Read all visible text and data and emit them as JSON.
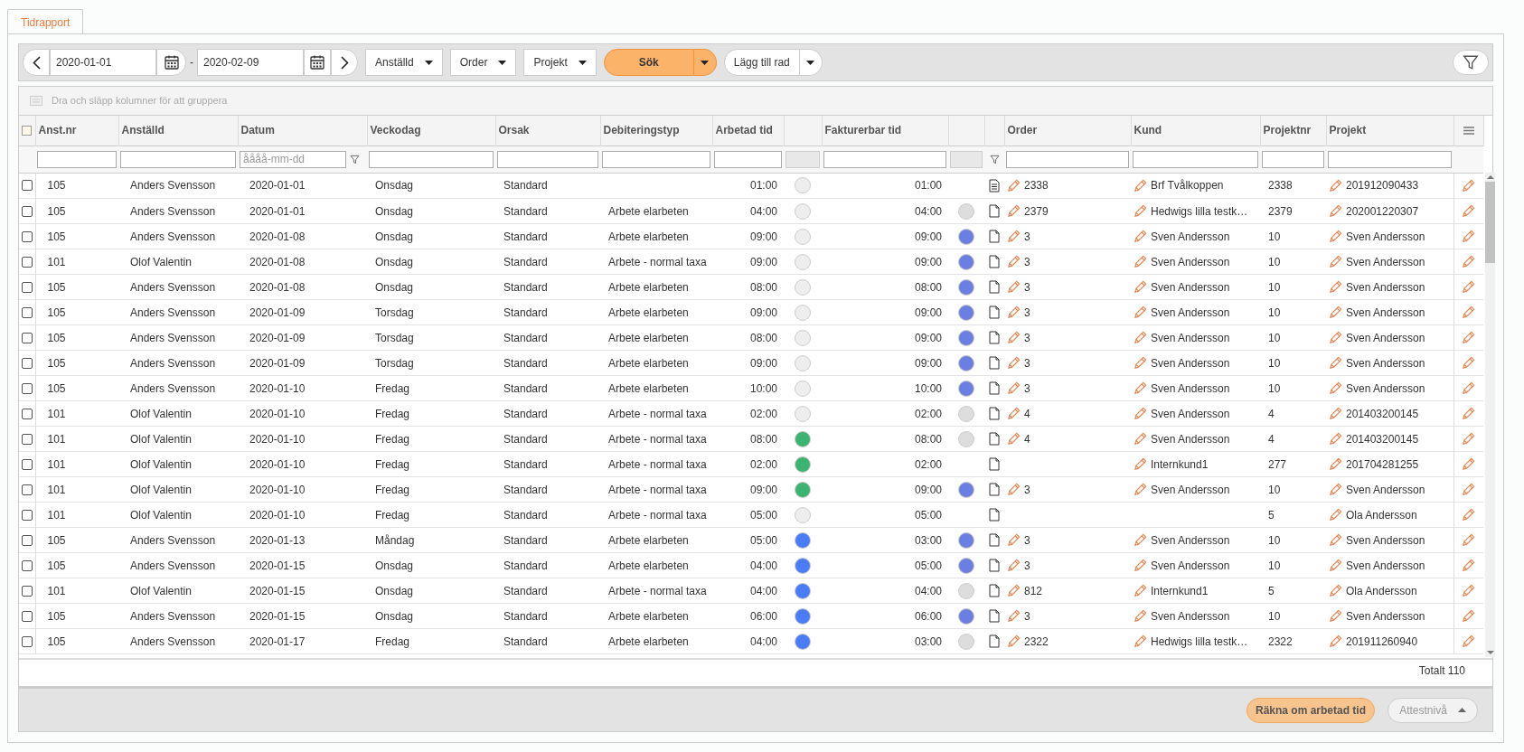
{
  "tabs": [
    {
      "label": "Tidrapport",
      "selected": true
    }
  ],
  "toolbar": {
    "date_from": "2020-01-01",
    "separator": "-",
    "date_to": "2020-02-09",
    "dropdowns": [
      "Anställd",
      "Order",
      "Projekt"
    ],
    "search_button": "Sök",
    "add_row_button": "Lägg till rad"
  },
  "group_panel": {
    "hint": "Dra och släpp kolumner för att gruppera"
  },
  "table": {
    "columns": [
      "Anst.nr",
      "Anställd",
      "Datum",
      "Veckodag",
      "Orsak",
      "Debiteringstyp",
      "Arbetad tid",
      "Fakturerbar tid",
      "Order",
      "Kund",
      "Projektnr",
      "Projekt"
    ],
    "all_selected": false,
    "date_filter_placeholder": "åååå-mm-dd",
    "rows": [
      {
        "selected": false,
        "emp_no": "105",
        "employee": "Anders Svensson",
        "date": "2020-01-01",
        "weekday": "Onsdag",
        "reason": "Standard",
        "worked": "01:00",
        "worked_status": {
          "color": "#eeeeee"
        },
        "billable": "01:00",
        "has_note": true,
        "order": "2338",
        "customer": "Brf Tvålkoppen",
        "project_no": "2338",
        "project": "201912090433"
      },
      {
        "selected": false,
        "emp_no": "105",
        "employee": "Anders Svensson",
        "date": "2020-01-01",
        "weekday": "Onsdag",
        "reason": "Standard",
        "billing_type": "Arbete elarbeten",
        "worked": "04:00",
        "worked_status": {
          "color": "#eeeeee"
        },
        "billable": "04:00",
        "billable_status": {
          "color": "#dddddd"
        },
        "has_note": false,
        "order": "2379",
        "customer": "Hedwigs lilla testk…",
        "project_no": "2379",
        "project": "202001220307"
      },
      {
        "selected": false,
        "emp_no": "105",
        "employee": "Anders Svensson",
        "date": "2020-01-08",
        "weekday": "Onsdag",
        "reason": "Standard",
        "billing_type": "Arbete elarbeten",
        "worked": "09:00",
        "worked_status": {
          "color": "#eeeeee"
        },
        "billable": "09:00",
        "billable_status": {
          "color": "#6b7fe0"
        },
        "has_note": false,
        "order": "3",
        "customer": "Sven Andersson",
        "project_no": "10",
        "project": "Sven Andersson"
      },
      {
        "selected": false,
        "emp_no": "101",
        "employee": "Olof Valentin",
        "date": "2020-01-08",
        "weekday": "Onsdag",
        "reason": "Standard",
        "billing_type": "Arbete - normal taxa",
        "worked": "09:00",
        "worked_status": {
          "color": "#eeeeee"
        },
        "billable": "09:00",
        "billable_status": {
          "color": "#6b7fe0"
        },
        "has_note": false,
        "order": "3",
        "customer": "Sven Andersson",
        "project_no": "10",
        "project": "Sven Andersson"
      },
      {
        "selected": false,
        "emp_no": "105",
        "employee": "Anders Svensson",
        "date": "2020-01-08",
        "weekday": "Onsdag",
        "reason": "Standard",
        "billing_type": "Arbete elarbeten",
        "worked": "08:00",
        "worked_status": {
          "color": "#eeeeee"
        },
        "billable": "08:00",
        "billable_status": {
          "color": "#6b7fe0"
        },
        "has_note": false,
        "order": "3",
        "customer": "Sven Andersson",
        "project_no": "10",
        "project": "Sven Andersson"
      },
      {
        "selected": false,
        "emp_no": "105",
        "employee": "Anders Svensson",
        "date": "2020-01-09",
        "weekday": "Torsdag",
        "reason": "Standard",
        "billing_type": "Arbete elarbeten",
        "worked": "09:00",
        "worked_status": {
          "color": "#eeeeee"
        },
        "billable": "09:00",
        "billable_status": {
          "color": "#6b7fe0"
        },
        "has_note": false,
        "order": "3",
        "customer": "Sven Andersson",
        "project_no": "10",
        "project": "Sven Andersson"
      },
      {
        "selected": false,
        "emp_no": "105",
        "employee": "Anders Svensson",
        "date": "2020-01-09",
        "weekday": "Torsdag",
        "reason": "Standard",
        "billing_type": "Arbete elarbeten",
        "worked": "08:00",
        "worked_status": {
          "color": "#eeeeee"
        },
        "billable": "09:00",
        "billable_status": {
          "color": "#6b7fe0"
        },
        "has_note": false,
        "order": "3",
        "customer": "Sven Andersson",
        "project_no": "10",
        "project": "Sven Andersson"
      },
      {
        "selected": false,
        "emp_no": "105",
        "employee": "Anders Svensson",
        "date": "2020-01-09",
        "weekday": "Torsdag",
        "reason": "Standard",
        "billing_type": "Arbete elarbeten",
        "worked": "09:00",
        "worked_status": {
          "color": "#eeeeee"
        },
        "billable": "09:00",
        "billable_status": {
          "color": "#6b7fe0"
        },
        "has_note": false,
        "order": "3",
        "customer": "Sven Andersson",
        "project_no": "10",
        "project": "Sven Andersson"
      },
      {
        "selected": false,
        "emp_no": "105",
        "employee": "Anders Svensson",
        "date": "2020-01-10",
        "weekday": "Fredag",
        "reason": "Standard",
        "billing_type": "Arbete elarbeten",
        "worked": "10:00",
        "worked_status": {
          "color": "#eeeeee"
        },
        "billable": "10:00",
        "billable_status": {
          "color": "#6b7fe0"
        },
        "has_note": false,
        "order": "3",
        "customer": "Sven Andersson",
        "project_no": "10",
        "project": "Sven Andersson"
      },
      {
        "selected": false,
        "emp_no": "101",
        "employee": "Olof Valentin",
        "date": "2020-01-10",
        "weekday": "Fredag",
        "reason": "Standard",
        "billing_type": "Arbete - normal taxa",
        "worked": "02:00",
        "worked_status": {
          "color": "#eeeeee"
        },
        "billable": "02:00",
        "billable_status": {
          "color": "#dddddd"
        },
        "has_note": false,
        "order": "4",
        "customer": "Sven Andersson",
        "project_no": "4",
        "project": "201403200145"
      },
      {
        "selected": false,
        "emp_no": "101",
        "employee": "Olof Valentin",
        "date": "2020-01-10",
        "weekday": "Fredag",
        "reason": "Standard",
        "billing_type": "Arbete - normal taxa",
        "worked": "08:00",
        "worked_status": {
          "color": "#3cb371"
        },
        "billable": "08:00",
        "billable_status": {
          "color": "#dddddd"
        },
        "has_note": false,
        "order": "4",
        "customer": "Sven Andersson",
        "project_no": "4",
        "project": "201403200145"
      },
      {
        "selected": false,
        "emp_no": "101",
        "employee": "Olof Valentin",
        "date": "2020-01-10",
        "weekday": "Fredag",
        "reason": "Standard",
        "billing_type": "Arbete - normal taxa",
        "worked": "02:00",
        "worked_status": {
          "color": "#3cb371"
        },
        "billable": "02:00",
        "has_note": false,
        "customer": "Internkund1",
        "project_no": "277",
        "project": "201704281255"
      },
      {
        "selected": false,
        "emp_no": "101",
        "employee": "Olof Valentin",
        "date": "2020-01-10",
        "weekday": "Fredag",
        "reason": "Standard",
        "billing_type": "Arbete - normal taxa",
        "worked": "09:00",
        "worked_status": {
          "color": "#3cb371"
        },
        "billable": "09:00",
        "billable_status": {
          "color": "#6b7fe0"
        },
        "has_note": false,
        "order": "3",
        "customer": "Sven Andersson",
        "project_no": "10",
        "project": "Sven Andersson"
      },
      {
        "selected": false,
        "emp_no": "101",
        "employee": "Olof Valentin",
        "date": "2020-01-10",
        "weekday": "Fredag",
        "reason": "Standard",
        "billing_type": "Arbete - normal taxa",
        "worked": "05:00",
        "worked_status": {
          "color": "#eeeeee"
        },
        "billable": "05:00",
        "has_note": false,
        "project_no": "5",
        "project": "Ola Andersson"
      },
      {
        "selected": false,
        "emp_no": "105",
        "employee": "Anders Svensson",
        "date": "2020-01-13",
        "weekday": "Måndag",
        "reason": "Standard",
        "billing_type": "Arbete elarbeten",
        "worked": "05:00",
        "worked_status": {
          "color": "#4a7cf5"
        },
        "billable": "03:00",
        "billable_status": {
          "color": "#6b7fe0"
        },
        "has_note": false,
        "order": "3",
        "customer": "Sven Andersson",
        "project_no": "10",
        "project": "Sven Andersson"
      },
      {
        "selected": false,
        "emp_no": "105",
        "employee": "Anders Svensson",
        "date": "2020-01-15",
        "weekday": "Onsdag",
        "reason": "Standard",
        "billing_type": "Arbete elarbeten",
        "worked": "04:00",
        "worked_status": {
          "color": "#4a7cf5"
        },
        "billable": "05:00",
        "billable_status": {
          "color": "#6b7fe0"
        },
        "has_note": false,
        "order": "3",
        "customer": "Sven Andersson",
        "project_no": "10",
        "project": "Sven Andersson"
      },
      {
        "selected": false,
        "emp_no": "101",
        "employee": "Olof Valentin",
        "date": "2020-01-15",
        "weekday": "Onsdag",
        "reason": "Standard",
        "billing_type": "Arbete - normal taxa",
        "worked": "04:00",
        "worked_status": {
          "color": "#4a7cf5"
        },
        "billable": "04:00",
        "billable_status": {
          "color": "#dddddd"
        },
        "has_note": false,
        "order": "812",
        "customer": "Internkund1",
        "project_no": "5",
        "project": "Ola Andersson"
      },
      {
        "selected": false,
        "emp_no": "105",
        "employee": "Anders Svensson",
        "date": "2020-01-15",
        "weekday": "Onsdag",
        "reason": "Standard",
        "billing_type": "Arbete elarbeten",
        "worked": "06:00",
        "worked_status": {
          "color": "#4a7cf5"
        },
        "billable": "06:00",
        "billable_status": {
          "color": "#6b7fe0"
        },
        "has_note": false,
        "order": "3",
        "customer": "Sven Andersson",
        "project_no": "10",
        "project": "Sven Andersson"
      },
      {
        "selected": false,
        "emp_no": "105",
        "employee": "Anders Svensson",
        "date": "2020-01-17",
        "weekday": "Fredag",
        "reason": "Standard",
        "billing_type": "Arbete elarbeten",
        "worked": "04:00",
        "worked_status": {
          "color": "#4a7cf5"
        },
        "billable": "03:00",
        "billable_status": {
          "color": "#dddddd"
        },
        "has_note": false,
        "order": "2322",
        "customer": "Hedwigs lilla testk…",
        "project_no": "2322",
        "project": "201911260940"
      }
    ],
    "total": "Totalt 110"
  },
  "bottom_bar": {
    "recalculate_button": "Räkna om arbetad tid",
    "attest_button": {
      "label": "Attestnivå",
      "disabled": true
    }
  }
}
